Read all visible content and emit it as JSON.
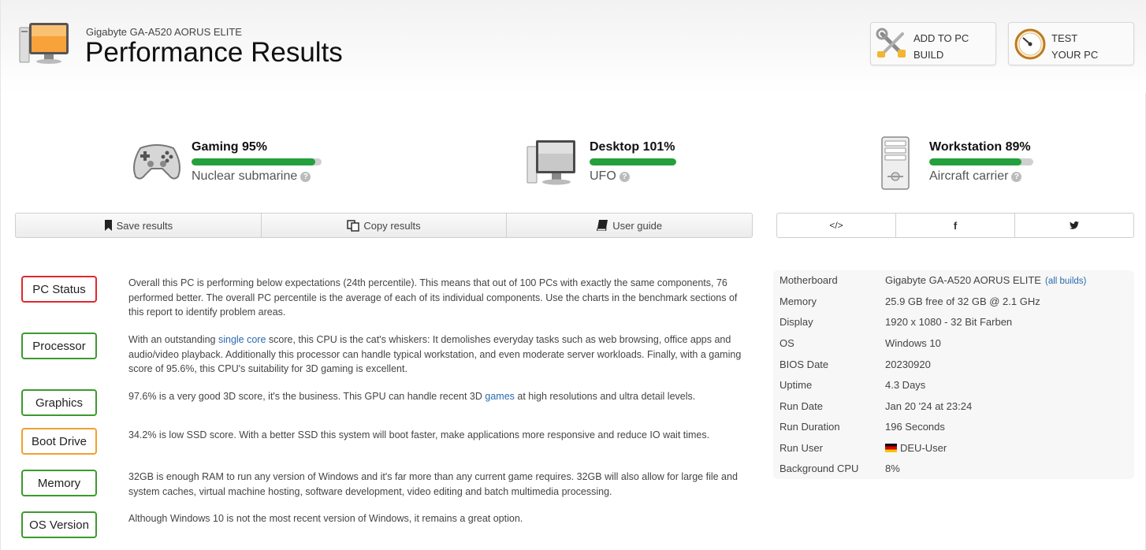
{
  "header": {
    "subtitle": "Gigabyte GA-A520 AORUS ELITE",
    "title": "Performance Results",
    "add_button": {
      "line1": "ADD TO PC",
      "line2": "BUILD",
      "icon": "tools-icon"
    },
    "test_button": {
      "line1": "TEST",
      "line2": "YOUR PC",
      "icon": "gauge-icon"
    }
  },
  "scores": [
    {
      "name": "Gaming 95%",
      "percent": 95,
      "desc": "Nuclear submarine",
      "icon": "gamepad-icon"
    },
    {
      "name": "Desktop 101%",
      "percent": 100,
      "desc": "UFO",
      "icon": "desktop-icon"
    },
    {
      "name": "Workstation 89%",
      "percent": 89,
      "desc": "Aircraft carrier",
      "icon": "tower-icon"
    }
  ],
  "actions": {
    "save": "Save results",
    "copy": "Copy results",
    "guide": "User guide"
  },
  "share": {
    "embed": "</>",
    "facebook": "f",
    "twitter": "twitter-icon"
  },
  "status": [
    {
      "label": "PC Status",
      "color": "#e0282e",
      "text": "Overall this PC is performing below expectations (24th percentile). This means that out of 100 PCs with exactly the same components, 76 performed better. The overall PC percentile is the average of each of its individual components. Use the charts in the benchmark sections of this report to identify problem areas."
    },
    {
      "label": "Processor",
      "color": "#3c9a2e",
      "text_before": "With an outstanding ",
      "link": "single core",
      "text_after": " score, this CPU is the cat's whiskers: It demolishes everyday tasks such as web browsing, office apps and audio/video playback. Additionally this processor can handle typical workstation, and even moderate server workloads. Finally, with a gaming score of 95.6%, this CPU's suitability for 3D gaming is excellent."
    },
    {
      "label": "Graphics",
      "color": "#3c9a2e",
      "text_before": "97.6% is a very good 3D score, it's the business. This GPU can handle recent 3D ",
      "link": "games",
      "text_after": " at high resolutions and ultra detail levels."
    },
    {
      "label": "Boot Drive",
      "color": "#f0a030",
      "text": "34.2% is low SSD score. With a better SSD this system will boot faster, make applications more responsive and reduce IO wait times."
    },
    {
      "label": "Memory",
      "color": "#3c9a2e",
      "text": "32GB is enough RAM to run any version of Windows and it's far more than any current game requires. 32GB will also allow for large file and system caches, virtual machine hosting, software development, video editing and batch multimedia processing."
    },
    {
      "label": "OS Version",
      "color": "#3c9a2e",
      "text": "Although Windows 10 is not the most recent version of Windows, it remains a great option."
    }
  ],
  "specs": [
    {
      "key": "Motherboard",
      "value": "Gigabyte GA-A520 AORUS ELITE",
      "link": "(all builds)"
    },
    {
      "key": "Memory",
      "value": "25.9 GB free of 32 GB @ 2.1 GHz"
    },
    {
      "key": "Display",
      "value": "1920 x 1080 - 32 Bit Farben"
    },
    {
      "key": "OS",
      "value": "Windows 10"
    },
    {
      "key": "BIOS Date",
      "value": "20230920"
    },
    {
      "key": "Uptime",
      "value": "4.3 Days"
    },
    {
      "key": "Run Date",
      "value": "Jan 20 '24 at 23:24"
    },
    {
      "key": "Run Duration",
      "value": "196 Seconds"
    },
    {
      "key": "Run User",
      "value": "DEU-User",
      "flag": "de-flag-icon"
    },
    {
      "key": "Background CPU",
      "value": "8%"
    }
  ]
}
